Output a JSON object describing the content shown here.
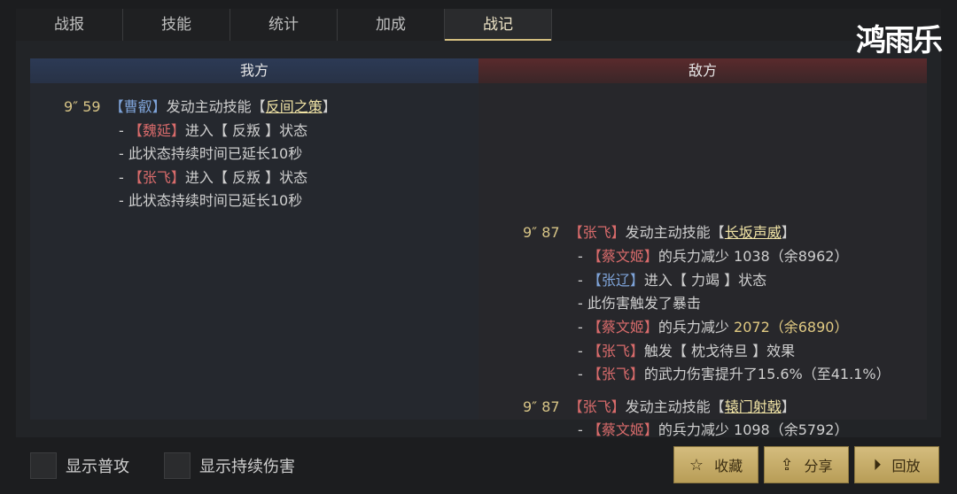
{
  "tabs": [
    "战报",
    "技能",
    "统计",
    "加成",
    "战记"
  ],
  "logo_text": "鸿雨乐",
  "headers": {
    "left": "我方",
    "right": "敌方"
  },
  "left_log": [
    {
      "time": "9″ 59",
      "actor": "曹叡",
      "text": "发动主动技能",
      "skill": "反间之策"
    },
    {
      "prefix": "-",
      "actor": "魏延",
      "text1": "进入",
      "state": "反叛",
      "text2": "状态"
    },
    {
      "prefix": "-",
      "text": "此状态持续时间已延长10秒"
    },
    {
      "prefix": "-",
      "actor": "张飞",
      "text1": "进入",
      "state": "反叛",
      "text2": "状态"
    },
    {
      "prefix": "-",
      "text": "此状态持续时间已延长10秒"
    }
  ],
  "right_log": [
    {
      "time": "9″ 87",
      "actor": "张飞",
      "text": "发动主动技能",
      "skill": "长坂声威"
    },
    {
      "prefix": "-",
      "actor": "蔡文姬",
      "text": "的兵力减少 1038（余8962）"
    },
    {
      "prefix": "-",
      "actor": "张辽",
      "text1": "进入",
      "state": "力竭",
      "text2": "状态"
    },
    {
      "prefix": "-",
      "text": "此伤害触发了暴击"
    },
    {
      "prefix": "-",
      "actor": "蔡文姬",
      "text": "的兵力减少",
      "value": "2072（余6890）"
    },
    {
      "prefix": "-",
      "actor": "张飞",
      "text1": "触发",
      "state": "枕戈待旦",
      "text2": "效果"
    },
    {
      "prefix": "-",
      "actor": "张飞",
      "text": "的武力伤害提升了15.6%（至41.1%）"
    },
    {
      "time": "9″ 87",
      "actor": "张飞",
      "text": "发动主动技能",
      "skill": "辕门射戟"
    },
    {
      "prefix": "-",
      "actor": "蔡文姬",
      "text": "的兵力减少 1098（余5792）"
    }
  ],
  "toggles": {
    "show_normal_attack": "显示普攻",
    "show_dot": "显示持续伤害"
  },
  "buttons": {
    "favorite": "收藏",
    "share": "分享",
    "replay": "回放"
  },
  "icons": {
    "favorite": "star-icon",
    "share": "share-icon",
    "replay": "play-icon"
  }
}
